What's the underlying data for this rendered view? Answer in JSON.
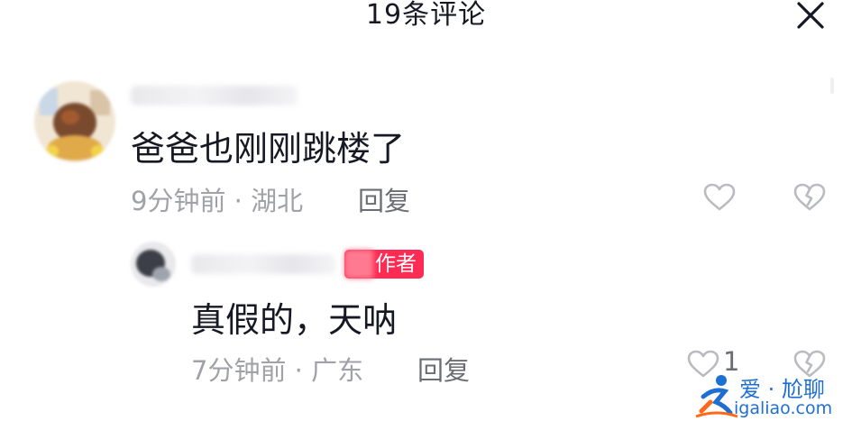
{
  "header": {
    "title": "19条评论"
  },
  "comments": [
    {
      "text": "爸爸也刚刚跳楼了",
      "time_location": "9分钟前 · 湖北",
      "reply_label": "回复"
    }
  ],
  "replies": [
    {
      "badge": "作者",
      "text": "真假的，天呐",
      "time_location": "7分钟前 · 广东",
      "reply_label": "回复",
      "like_count": "1"
    }
  ],
  "watermark": {
    "brand": "爱 · 尬聊",
    "url": "igaliao.com"
  },
  "colors": {
    "author_badge": "#fe2c55",
    "meta_text": "#a0a2a8",
    "watermark": "#1f6fd1"
  }
}
